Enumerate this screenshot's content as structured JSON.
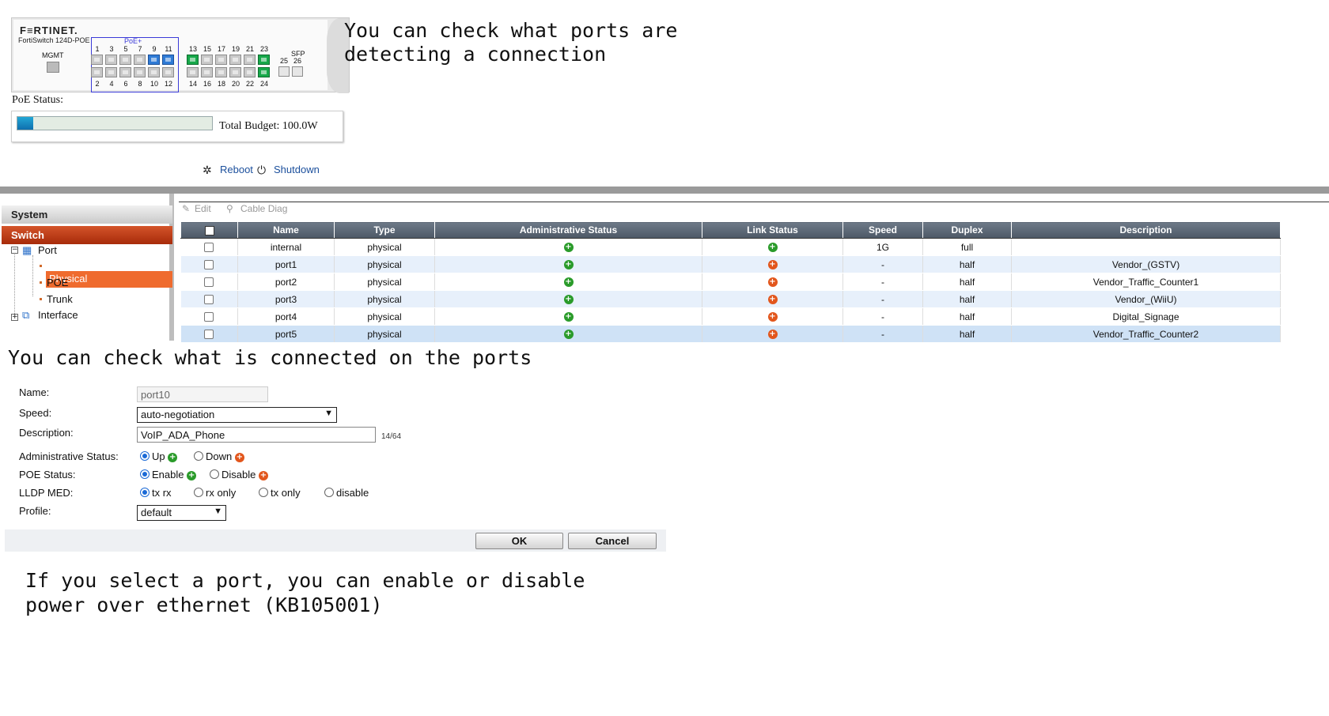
{
  "captions": {
    "ports_detect": "You can check what ports are\ndetecting a connection",
    "connected": "You can check what is connected on the ports",
    "poe_select": "If you select a port, you can enable or disable\npower over ethernet (KB105001)"
  },
  "faceplate": {
    "logo": "F≡RTINET.",
    "model": "FortiSwitch 124D-POE",
    "mgmt_label": "MGMT",
    "poe_label": "PoE+",
    "sfp_label": "SFP",
    "top_numbers": [
      "1",
      "3",
      "5",
      "7",
      "9",
      "11",
      "13",
      "15",
      "17",
      "19",
      "21",
      "23"
    ],
    "bottom_numbers": [
      "2",
      "4",
      "6",
      "8",
      "10",
      "12",
      "14",
      "16",
      "18",
      "20",
      "22",
      "24"
    ],
    "sfp_numbers": [
      "25",
      "26"
    ],
    "top_port_states": [
      "off",
      "off",
      "off",
      "off",
      "blue",
      "blue",
      "green",
      "off",
      "off",
      "off",
      "off",
      "green"
    ],
    "bottom_port_states": [
      "off",
      "off",
      "off",
      "off",
      "off",
      "off",
      "off",
      "off",
      "off",
      "off",
      "off",
      "green"
    ]
  },
  "poe": {
    "status_label": "PoE Status:",
    "budget_text": "Total Budget: 100.0W",
    "usage_fraction": 0.08
  },
  "actions": {
    "reboot": "Reboot",
    "shutdown": "Shutdown"
  },
  "sidebar": {
    "system": "System",
    "switch": "Switch",
    "tree": {
      "port": "Port",
      "physical": "Physical",
      "poe": "POE",
      "trunk": "Trunk",
      "interface": "Interface"
    }
  },
  "toolbar": {
    "edit": "Edit",
    "cable_diag": "Cable Diag"
  },
  "table": {
    "headers": {
      "name": "Name",
      "type": "Type",
      "admin_status": "Administrative Status",
      "link_status": "Link Status",
      "speed": "Speed",
      "duplex": "Duplex",
      "description": "Description"
    },
    "rows": [
      {
        "name": "internal",
        "type": "physical",
        "admin": "up",
        "link": "up",
        "speed": "1G",
        "duplex": "full",
        "description": ""
      },
      {
        "name": "port1",
        "type": "physical",
        "admin": "up",
        "link": "down",
        "speed": "-",
        "duplex": "half",
        "description": "Vendor_(GSTV)"
      },
      {
        "name": "port2",
        "type": "physical",
        "admin": "up",
        "link": "down",
        "speed": "-",
        "duplex": "half",
        "description": "Vendor_Traffic_Counter1"
      },
      {
        "name": "port3",
        "type": "physical",
        "admin": "up",
        "link": "down",
        "speed": "-",
        "duplex": "half",
        "description": "Vendor_(WiiU)"
      },
      {
        "name": "port4",
        "type": "physical",
        "admin": "up",
        "link": "down",
        "speed": "-",
        "duplex": "half",
        "description": "Digital_Signage"
      },
      {
        "name": "port5",
        "type": "physical",
        "admin": "up",
        "link": "down",
        "speed": "-",
        "duplex": "half",
        "description": "Vendor_Traffic_Counter2"
      }
    ]
  },
  "form": {
    "name_label": "Name:",
    "name_value": "port10",
    "speed_label": "Speed:",
    "speed_value": "auto-negotiation",
    "description_label": "Description:",
    "description_value": "VoIP_ADA_Phone",
    "description_counter": "14/64",
    "admin_label": "Administrative Status:",
    "admin_up": "Up",
    "admin_down": "Down",
    "poe_label": "POE Status:",
    "poe_enable": "Enable",
    "poe_disable": "Disable",
    "lldp_label": "LLDP MED:",
    "lldp_txrx": "tx rx",
    "lldp_rxonly": "rx only",
    "lldp_txonly": "tx only",
    "lldp_disable": "disable",
    "profile_label": "Profile:",
    "profile_value": "default",
    "ok": "OK",
    "cancel": "Cancel"
  },
  "colors": {
    "switch_header": "#b63a12",
    "selected_item": "#ef6b2e",
    "table_header": "#5a6573",
    "status_up": "#2a9b2a",
    "status_down": "#e2561c",
    "port_active_green": "#17a84a",
    "port_active_blue": "#2f7bd6"
  }
}
